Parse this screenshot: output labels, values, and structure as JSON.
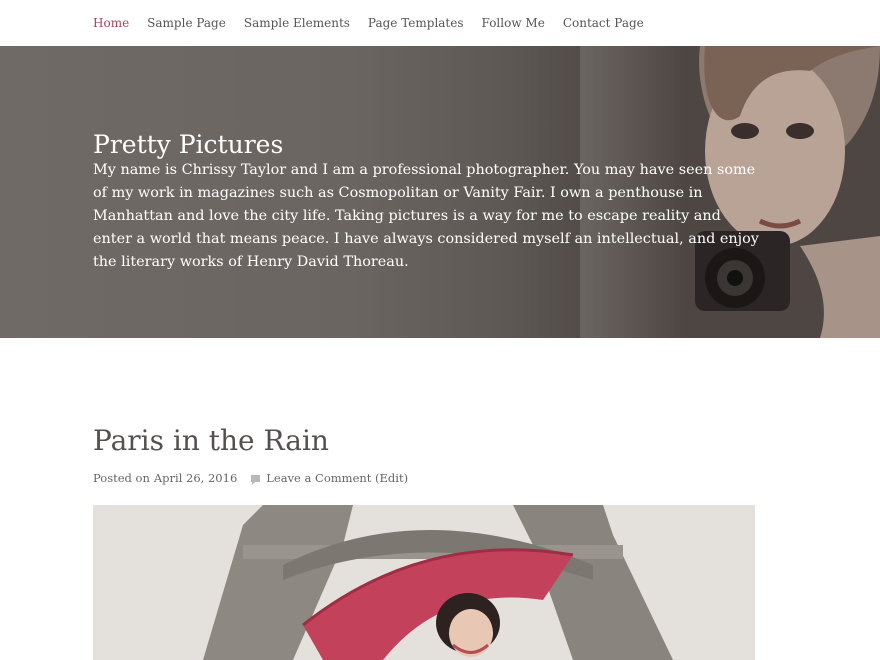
{
  "nav": {
    "items": [
      {
        "label": "Home",
        "active": true
      },
      {
        "label": "Sample Page",
        "active": false
      },
      {
        "label": "Sample Elements",
        "active": false
      },
      {
        "label": "Page Templates",
        "active": false
      },
      {
        "label": "Follow Me",
        "active": false
      },
      {
        "label": "Contact Page",
        "active": false
      }
    ]
  },
  "hero": {
    "title": "Pretty Pictures",
    "text": "My name is Chrissy Taylor and I am a professional photographer. You may have seen some of my work in magazines such as Cosmopolitan or Vanity Fair. I own a penthouse in Manhattan and love the city life. Taking pictures is a way for me to escape reality and enter a world that means peace. I have always considered myself an intellectual, and enjoy the literary works of Henry David Thoreau."
  },
  "post": {
    "title": "Paris in the Rain",
    "posted_on": "Posted on",
    "date": "April 26, 2016",
    "comments": "Leave a Comment (Edit)",
    "comment_icon": "comment-icon"
  },
  "colors": {
    "accent": "#a0455a",
    "hero_overlay": "#6b6561",
    "text": "#4a4a4a"
  }
}
